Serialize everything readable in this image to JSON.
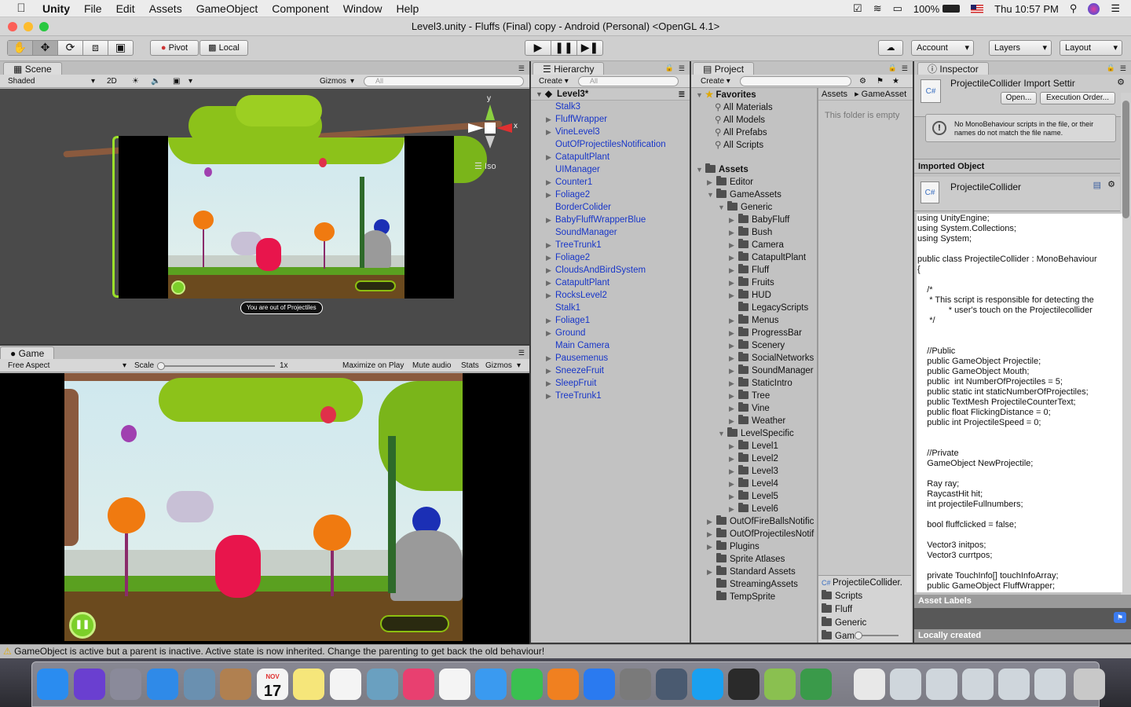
{
  "menubar": {
    "app": "Unity",
    "items": [
      "File",
      "Edit",
      "Assets",
      "GameObject",
      "Component",
      "Window",
      "Help"
    ],
    "battery": "100%",
    "clock": "Thu 10:57 PM"
  },
  "window": {
    "title": "Level3.unity - Fluffs (Final) copy - Android (Personal) <OpenGL 4.1>"
  },
  "toolbar": {
    "pivot": "Pivot",
    "local": "Local",
    "account": "Account",
    "layers": "Layers",
    "layout": "Layout"
  },
  "scene": {
    "tab": "Scene",
    "shading": "Shaded",
    "mode2d": "2D",
    "gizmos": "Gizmos",
    "search_placeholder": "All",
    "iso": "Iso",
    "axis_y": "y",
    "axis_x": "x",
    "toast": "You are out of Projectiles"
  },
  "game": {
    "tab": "Game",
    "aspect": "Free Aspect",
    "scale_label": "Scale",
    "scale_value": "1x",
    "maximize": "Maximize on Play",
    "mute": "Mute audio",
    "stats": "Stats",
    "gizmos": "Gizmos"
  },
  "hierarchy": {
    "tab": "Hierarchy",
    "create": "Create",
    "search_placeholder": "All",
    "root": "Level3*",
    "items": [
      {
        "label": "Stalk3",
        "expandable": false
      },
      {
        "label": "FluffWrapper",
        "expandable": true
      },
      {
        "label": "VineLevel3",
        "expandable": true
      },
      {
        "label": "OutOfProjectilesNotification",
        "expandable": false
      },
      {
        "label": "CatapultPlant",
        "expandable": true
      },
      {
        "label": "UIManager",
        "expandable": false
      },
      {
        "label": "Counter1",
        "expandable": true
      },
      {
        "label": "Foliage2",
        "expandable": true
      },
      {
        "label": "BorderColider",
        "expandable": false
      },
      {
        "label": "BabyFluffWrapperBlue",
        "expandable": true
      },
      {
        "label": "SoundManager",
        "expandable": false
      },
      {
        "label": "TreeTrunk1",
        "expandable": true
      },
      {
        "label": "Foliage2",
        "expandable": true
      },
      {
        "label": "CloudsAndBirdSystem",
        "expandable": true
      },
      {
        "label": "CatapultPlant",
        "expandable": true
      },
      {
        "label": "RocksLevel2",
        "expandable": true
      },
      {
        "label": "Stalk1",
        "expandable": false
      },
      {
        "label": "Foliage1",
        "expandable": true
      },
      {
        "label": "Ground",
        "expandable": true
      },
      {
        "label": "Main Camera",
        "expandable": false
      },
      {
        "label": "Pausemenus",
        "expandable": true
      },
      {
        "label": "SneezeFruit",
        "expandable": true
      },
      {
        "label": "SleepFruit",
        "expandable": true
      },
      {
        "label": "TreeTrunk1",
        "expandable": true
      }
    ]
  },
  "project": {
    "tab": "Project",
    "create": "Create",
    "favorites": "Favorites",
    "fav_items": [
      "All Materials",
      "All Models",
      "All Prefabs",
      "All Scripts"
    ],
    "assets_root": "Assets",
    "tree": [
      {
        "label": "Editor",
        "depth": 1,
        "arrow": "right"
      },
      {
        "label": "GameAssets",
        "depth": 1,
        "arrow": "down"
      },
      {
        "label": "Generic",
        "depth": 2,
        "arrow": "down"
      },
      {
        "label": "BabyFluff",
        "depth": 3,
        "arrow": "right"
      },
      {
        "label": "Bush",
        "depth": 3,
        "arrow": "right"
      },
      {
        "label": "Camera",
        "depth": 3,
        "arrow": "right"
      },
      {
        "label": "CatapultPlant",
        "depth": 3,
        "arrow": "right"
      },
      {
        "label": "Fluff",
        "depth": 3,
        "arrow": "right"
      },
      {
        "label": "Fruits",
        "depth": 3,
        "arrow": "right"
      },
      {
        "label": "HUD",
        "depth": 3,
        "arrow": "right"
      },
      {
        "label": "LegacyScripts",
        "depth": 3,
        "arrow": ""
      },
      {
        "label": "Menus",
        "depth": 3,
        "arrow": "right"
      },
      {
        "label": "ProgressBar",
        "depth": 3,
        "arrow": "right"
      },
      {
        "label": "Scenery",
        "depth": 3,
        "arrow": "right"
      },
      {
        "label": "SocialNetworks",
        "depth": 3,
        "arrow": "right"
      },
      {
        "label": "SoundManager",
        "depth": 3,
        "arrow": "right"
      },
      {
        "label": "StaticIntro",
        "depth": 3,
        "arrow": "right"
      },
      {
        "label": "Tree",
        "depth": 3,
        "arrow": "right"
      },
      {
        "label": "Vine",
        "depth": 3,
        "arrow": "right"
      },
      {
        "label": "Weather",
        "depth": 3,
        "arrow": "right"
      },
      {
        "label": "LevelSpecific",
        "depth": 2,
        "arrow": "down"
      },
      {
        "label": "Level1",
        "depth": 3,
        "arrow": "right"
      },
      {
        "label": "Level2",
        "depth": 3,
        "arrow": "right"
      },
      {
        "label": "Level3",
        "depth": 3,
        "arrow": "right"
      },
      {
        "label": "Level4",
        "depth": 3,
        "arrow": "right"
      },
      {
        "label": "Level5",
        "depth": 3,
        "arrow": "right"
      },
      {
        "label": "Level6",
        "depth": 3,
        "arrow": "right"
      },
      {
        "label": "OutOfFireBallsNotific",
        "depth": 1,
        "arrow": "right"
      },
      {
        "label": "OutOfProjectilesNotif",
        "depth": 1,
        "arrow": "right"
      },
      {
        "label": "Plugins",
        "depth": 1,
        "arrow": "right"
      },
      {
        "label": "Sprite Atlases",
        "depth": 1,
        "arrow": ""
      },
      {
        "label": "Standard Assets",
        "depth": 1,
        "arrow": "right"
      },
      {
        "label": "StreamingAssets",
        "depth": 1,
        "arrow": ""
      },
      {
        "label": "TempSprite",
        "depth": 1,
        "arrow": ""
      }
    ],
    "breadcrumb": [
      "Assets",
      "GameAsset"
    ],
    "empty_note": "This folder is empty",
    "bottom_list": [
      "ProjectileCollider.",
      "Scripts",
      "Fluff",
      "Generic",
      "Gam"
    ]
  },
  "inspector": {
    "tab": "Inspector",
    "title": "ProjectileCollider Import Settir",
    "open": "Open...",
    "execution_order": "Execution Order...",
    "warning": "No MonoBehaviour scripts in the file, or their names do not match the file name.",
    "imported_object": "Imported Object",
    "object_name": "ProjectileCollider",
    "code": [
      "using UnityEngine;",
      "using System.Collections;",
      "using System;",
      "",
      "public class ProjectileCollider : MonoBehaviour",
      "{",
      "",
      "    /*",
      "     * This script is responsible for detecting the",
      "             * user's touch on the Projectilecollider",
      "     */",
      "",
      "",
      "    //Public",
      "    public GameObject Projectile;",
      "    public GameObject Mouth;",
      "    public  int NumberOfProjectiles = 5;",
      "    public static int staticNumberOfProjectiles;",
      "    public TextMesh ProjectileCounterText;",
      "    public float FlickingDistance = 0;",
      "    public int ProjectileSpeed = 0;",
      "",
      "",
      "    //Private",
      "    GameObject NewProjectile;",
      "",
      "    Ray ray;",
      "    RaycastHit hit;",
      "    int projectileFullnumbers;",
      "",
      "    bool fluffclicked = false;",
      "",
      "    Vector3 initpos;",
      "    Vector3 currtpos;",
      "",
      "    private TouchInfo[] touchInfoArray;",
      "    public GameObject FluffWrapper;"
    ],
    "asset_labels": "Asset Labels",
    "locally_created": "Locally created"
  },
  "status": {
    "message": "GameObject is active but a parent is inactive. Active state is now inherited. Change the parenting to get back the old behaviour!"
  },
  "dock": {
    "calendar_month": "NOV",
    "calendar_day": "17",
    "icons": [
      "finder-icon",
      "siri-icon",
      "launchpad-icon",
      "safari-icon",
      "preview-icon",
      "contacts-icon",
      "calendar-icon",
      "notes-icon",
      "reminders-icon",
      "photo-booth-icon",
      "itunes-icon",
      "photos-icon",
      "messages-icon",
      "facetime-icon",
      "ibooks-icon",
      "app-store-icon",
      "system-preferences-icon",
      "network-utility-icon",
      "skype-icon",
      "unity-icon",
      "android-file-transfer-icon",
      "android-studio-icon",
      "archive-icon",
      "screenshot-1-icon",
      "screenshot-2-icon",
      "screenshot-3-icon",
      "screenshot-4-icon",
      "screenshot-5-icon",
      "trash-icon"
    ]
  },
  "colors": {
    "accent": "#3b7bf0",
    "link": "#1836c8",
    "game_grass": "#5aa020",
    "fluff_pink": "#e8154c",
    "fluff_blue": "#1b2fb5",
    "tree_orange": "#f07a10"
  }
}
